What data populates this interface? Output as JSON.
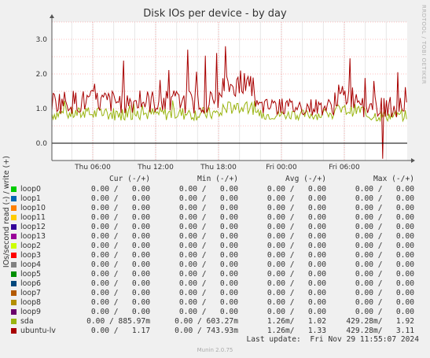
{
  "chart_data": {
    "type": "line",
    "title": "Disk IOs per device - by day",
    "ylabel": "IOs/second read (-) / write (+)",
    "ylim": [
      -0.5,
      3.5
    ],
    "y_ticks": [
      "0.0",
      "1.0",
      "2.0",
      "3.0"
    ],
    "x_ticks": [
      "Thu 06:00",
      "Thu 12:00",
      "Thu 18:00",
      "Fri 00:00",
      "Fri 06:00"
    ],
    "x_tick_hours": [
      6,
      12,
      18,
      24,
      30
    ],
    "x_range_hours": [
      2.1,
      36.0
    ],
    "grid": true,
    "colors": {
      "sda": "#99b410",
      "ubuntu-lv": "#a80000",
      "zero_line": "#000000",
      "grid": "#ff8080",
      "background": "#ffffff"
    },
    "series": [
      {
        "name": "sda",
        "segments": [
          {
            "from_hour": 2.1,
            "to_hour": 18.3,
            "mean": 0.85,
            "amp": 0.2,
            "peak": 1.25
          },
          {
            "from_hour": 18.3,
            "to_hour": 21.5,
            "mean": 1.02,
            "amp": 0.2,
            "peak": 1.3
          },
          {
            "from_hour": 21.5,
            "to_hour": 29.2,
            "mean": 0.82,
            "amp": 0.15,
            "peak": 1.05
          },
          {
            "from_hour": 29.2,
            "to_hour": 31.8,
            "mean": 0.95,
            "amp": 0.18,
            "peak": 1.45
          },
          {
            "from_hour": 31.8,
            "to_hour": 36.0,
            "mean": 0.8,
            "amp": 0.18,
            "peak": 1.1
          }
        ]
      },
      {
        "name": "ubuntu-lv",
        "segments": [
          {
            "from_hour": 2.1,
            "to_hour": 18.3,
            "mean": 1.2,
            "amp": 0.35,
            "peak": 2.7
          },
          {
            "from_hour": 18.3,
            "to_hour": 21.5,
            "mean": 1.65,
            "amp": 0.3,
            "peak": 2.2
          },
          {
            "from_hour": 21.5,
            "to_hour": 29.2,
            "mean": 1.05,
            "amp": 0.25,
            "peak": 1.7
          },
          {
            "from_hour": 29.2,
            "to_hour": 31.8,
            "mean": 1.35,
            "amp": 0.35,
            "peak": 2.3
          },
          {
            "from_hour": 31.8,
            "to_hour": 36.0,
            "mean": 1.05,
            "amp": 0.3,
            "peak": 1.9
          }
        ],
        "spikes": [
          {
            "hour": 15.1,
            "value": 2.7
          },
          {
            "hour": 18.7,
            "value": 2.8
          },
          {
            "hour": 30.5,
            "value": 2.45
          },
          {
            "hour": 35.1,
            "value": 2.05
          }
        ],
        "dips": [
          {
            "hour": 33.7,
            "value": -0.45
          }
        ]
      }
    ]
  },
  "legend": {
    "headers": {
      "cur": "Cur (-/+)",
      "min": "Min (-/+)",
      "avg": "Avg (-/+)",
      "max": "Max (-/+)"
    },
    "rows": [
      {
        "name": "loop0",
        "color": "#00cc00",
        "cur": "0.00 /   0.00",
        "min": "0.00 /   0.00",
        "avg": "0.00 /   0.00",
        "max": "0.00 /   0.00"
      },
      {
        "name": "loop1",
        "color": "#0066b3",
        "cur": "0.00 /   0.00",
        "min": "0.00 /   0.00",
        "avg": "0.00 /   0.00",
        "max": "0.00 /   0.00"
      },
      {
        "name": "loop10",
        "color": "#ff8000",
        "cur": "0.00 /   0.00",
        "min": "0.00 /   0.00",
        "avg": "0.00 /   0.00",
        "max": "0.00 /   0.00"
      },
      {
        "name": "loop11",
        "color": "#ffcc00",
        "cur": "0.00 /   0.00",
        "min": "0.00 /   0.00",
        "avg": "0.00 /   0.00",
        "max": "0.00 /   0.00"
      },
      {
        "name": "loop12",
        "color": "#330099",
        "cur": "0.00 /   0.00",
        "min": "0.00 /   0.00",
        "avg": "0.00 /   0.00",
        "max": "0.00 /   0.00"
      },
      {
        "name": "loop13",
        "color": "#990099",
        "cur": "0.00 /   0.00",
        "min": "0.00 /   0.00",
        "avg": "0.00 /   0.00",
        "max": "0.00 /   0.00"
      },
      {
        "name": "loop2",
        "color": "#ccff00",
        "cur": "0.00 /   0.00",
        "min": "0.00 /   0.00",
        "avg": "0.00 /   0.00",
        "max": "0.00 /   0.00"
      },
      {
        "name": "loop3",
        "color": "#ff0000",
        "cur": "0.00 /   0.00",
        "min": "0.00 /   0.00",
        "avg": "0.00 /   0.00",
        "max": "0.00 /   0.00"
      },
      {
        "name": "loop4",
        "color": "#808080",
        "cur": "0.00 /   0.00",
        "min": "0.00 /   0.00",
        "avg": "0.00 /   0.00",
        "max": "0.00 /   0.00"
      },
      {
        "name": "loop5",
        "color": "#008f00",
        "cur": "0.00 /   0.00",
        "min": "0.00 /   0.00",
        "avg": "0.00 /   0.00",
        "max": "0.00 /   0.00"
      },
      {
        "name": "loop6",
        "color": "#00487d",
        "cur": "0.00 /   0.00",
        "min": "0.00 /   0.00",
        "avg": "0.00 /   0.00",
        "max": "0.00 /   0.00"
      },
      {
        "name": "loop7",
        "color": "#b35a00",
        "cur": "0.00 /   0.00",
        "min": "0.00 /   0.00",
        "avg": "0.00 /   0.00",
        "max": "0.00 /   0.00"
      },
      {
        "name": "loop8",
        "color": "#b38f00",
        "cur": "0.00 /   0.00",
        "min": "0.00 /   0.00",
        "avg": "0.00 /   0.00",
        "max": "0.00 /   0.00"
      },
      {
        "name": "loop9",
        "color": "#6b006b",
        "cur": "0.00 /   0.00",
        "min": "0.00 /   0.00",
        "avg": "0.00 /   0.00",
        "max": "0.00 /   0.00"
      },
      {
        "name": "sda",
        "color": "#99b410",
        "cur": "0.00 / 885.97m",
        "min": "0.00 / 603.27m",
        "avg": "1.26m/   1.02",
        "max": "429.28m/   1.92"
      },
      {
        "name": "ubuntu-lv",
        "color": "#a80000",
        "cur": "0.00 /   1.17",
        "min": "0.00 / 743.93m",
        "avg": "1.26m/   1.33",
        "max": "429.28m/   3.11"
      }
    ]
  },
  "footer": {
    "last_update": "Last update:  Fri Nov 29 11:55:07 2024",
    "version": "Munin 2.0.75",
    "side_credit": "RRDTOOL / TOBI OETIKER"
  }
}
